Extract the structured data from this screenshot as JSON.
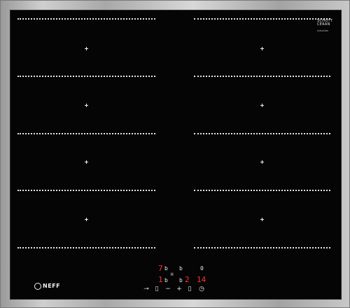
{
  "brand": {
    "panel_maker": "SCHOTT CERAN",
    "panel_sub": "induction",
    "logo": "NEFF"
  },
  "zones": {
    "left_front_level": "7",
    "left_rear_level": "1",
    "right_front_level": "b",
    "timer_display": "14",
    "left_front_suffix": "b",
    "left_rear_suffix": "b",
    "right_rear_level": "b",
    "right_rear_value": "2",
    "center_label": "H",
    "right_top_icon": "0"
  },
  "controls": [
    {
      "id": "lock",
      "icon": "key-lock-icon",
      "glyph": "⊸"
    },
    {
      "id": "select",
      "icon": "zone-select-icon",
      "glyph": "▯"
    },
    {
      "id": "minus",
      "icon": "minus-icon",
      "glyph": "−"
    },
    {
      "id": "plus",
      "icon": "plus-icon",
      "glyph": "+"
    },
    {
      "id": "select2",
      "icon": "zone-select-icon",
      "glyph": "▯"
    },
    {
      "id": "timer",
      "icon": "timer-icon",
      "glyph": "◷"
    }
  ],
  "colors": {
    "glass": "#050505",
    "display_red": "#ff3030",
    "marking": "#e6e6e6"
  }
}
